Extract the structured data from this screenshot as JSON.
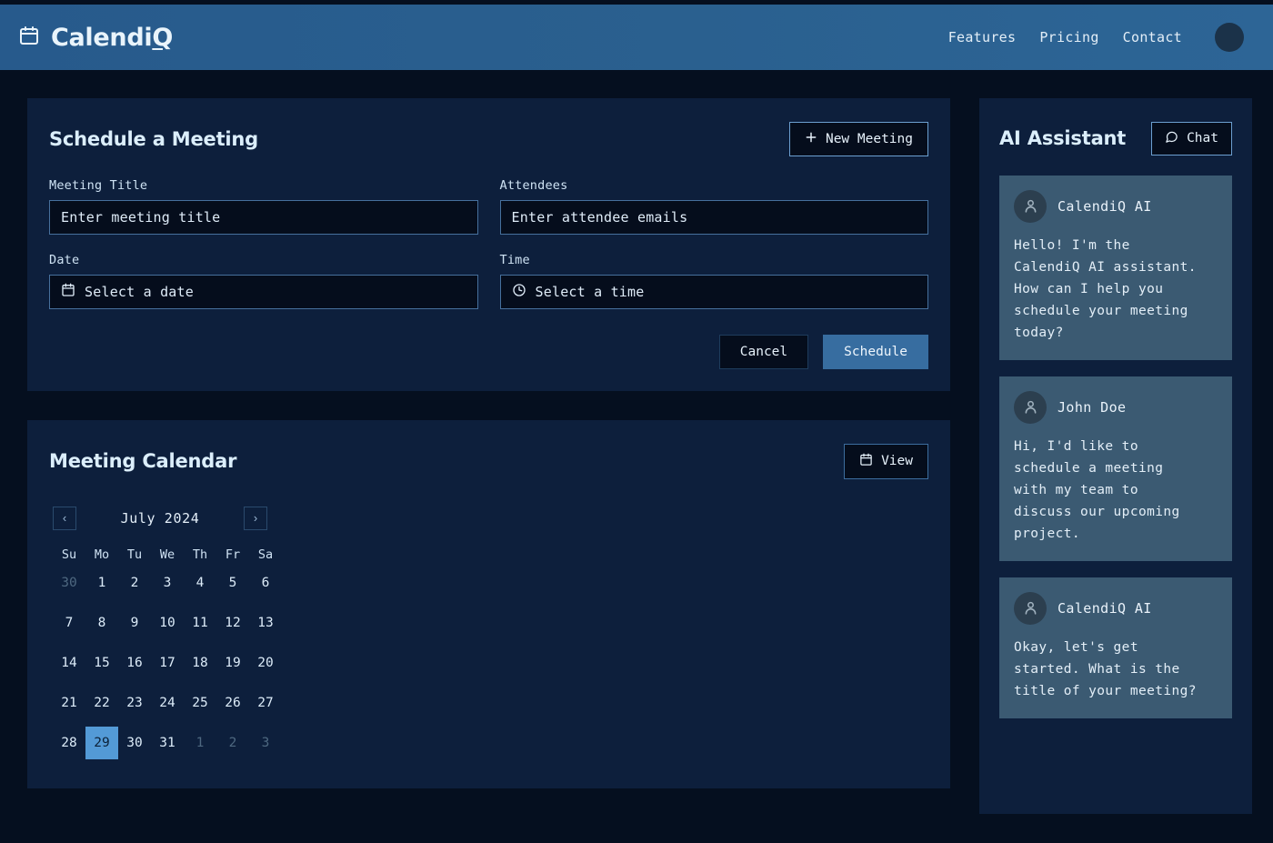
{
  "header": {
    "brand_icon": "calendar-icon",
    "brand_name_main": "Calendi",
    "brand_name_accent": "Q",
    "nav": [
      {
        "label": "Features"
      },
      {
        "label": "Pricing"
      },
      {
        "label": "Contact"
      }
    ],
    "avatar": "user-avatar"
  },
  "schedule_card": {
    "title": "Schedule a Meeting",
    "new_meeting_button": "New Meeting",
    "new_meeting_icon": "plus-icon",
    "fields": {
      "meeting_title": {
        "label": "Meeting Title",
        "placeholder": "Enter meeting title",
        "value": ""
      },
      "attendees": {
        "label": "Attendees",
        "placeholder": "Enter attendee emails",
        "value": ""
      },
      "date": {
        "label": "Date",
        "placeholder": "Select a date",
        "value": "",
        "icon": "calendar-icon"
      },
      "time": {
        "label": "Time",
        "placeholder": "Select a time",
        "value": "",
        "icon": "clock-icon"
      }
    },
    "cancel_button": "Cancel",
    "schedule_button": "Schedule"
  },
  "calendar_card": {
    "title": "Meeting Calendar",
    "view_button": "View",
    "view_icon": "calendar-icon",
    "prev_label": "‹",
    "next_label": "›",
    "month_label": "July 2024",
    "day_headers": [
      "Su",
      "Mo",
      "Tu",
      "We",
      "Th",
      "Fr",
      "Sa"
    ],
    "days": [
      {
        "n": "30",
        "state": "muted"
      },
      {
        "n": "1",
        "state": "normal"
      },
      {
        "n": "2",
        "state": "normal"
      },
      {
        "n": "3",
        "state": "normal"
      },
      {
        "n": "4",
        "state": "normal"
      },
      {
        "n": "5",
        "state": "normal"
      },
      {
        "n": "6",
        "state": "normal"
      },
      {
        "n": "7",
        "state": "normal"
      },
      {
        "n": "8",
        "state": "normal"
      },
      {
        "n": "9",
        "state": "normal"
      },
      {
        "n": "10",
        "state": "normal"
      },
      {
        "n": "11",
        "state": "normal"
      },
      {
        "n": "12",
        "state": "normal"
      },
      {
        "n": "13",
        "state": "normal"
      },
      {
        "n": "14",
        "state": "normal"
      },
      {
        "n": "15",
        "state": "normal"
      },
      {
        "n": "16",
        "state": "normal"
      },
      {
        "n": "17",
        "state": "normal"
      },
      {
        "n": "18",
        "state": "normal"
      },
      {
        "n": "19",
        "state": "normal"
      },
      {
        "n": "20",
        "state": "normal"
      },
      {
        "n": "21",
        "state": "normal"
      },
      {
        "n": "22",
        "state": "normal"
      },
      {
        "n": "23",
        "state": "normal"
      },
      {
        "n": "24",
        "state": "normal"
      },
      {
        "n": "25",
        "state": "normal"
      },
      {
        "n": "26",
        "state": "normal"
      },
      {
        "n": "27",
        "state": "normal"
      },
      {
        "n": "28",
        "state": "normal"
      },
      {
        "n": "29",
        "state": "selected"
      },
      {
        "n": "30",
        "state": "normal"
      },
      {
        "n": "31",
        "state": "normal"
      },
      {
        "n": "1",
        "state": "muted"
      },
      {
        "n": "2",
        "state": "muted"
      },
      {
        "n": "3",
        "state": "muted"
      }
    ]
  },
  "assistant": {
    "title": "AI Assistant",
    "chat_button": "Chat",
    "chat_icon": "message-bubble-icon",
    "messages": [
      {
        "author": "CalendiQ AI",
        "avatar": "user-icon",
        "text": "Hello! I'm the\nCalendiQ AI assistant.\nHow can I help you\nschedule your meeting\ntoday?"
      },
      {
        "author": "John Doe",
        "avatar": "user-icon",
        "text": "Hi, I'd like to\nschedule a meeting\nwith my team to\ndiscuss our upcoming\nproject."
      },
      {
        "author": "CalendiQ AI",
        "avatar": "user-icon",
        "text": "Okay, let's get\nstarted. What is the\ntitle of your meeting?"
      }
    ]
  },
  "colors": {
    "header_blue": "#2a5d8f",
    "page_bg": "#050f1f",
    "card_bg": "#0d1f3c",
    "accent": "#376da0",
    "selected_day": "#539ad6",
    "bubble_bg": "#3b5a72"
  }
}
